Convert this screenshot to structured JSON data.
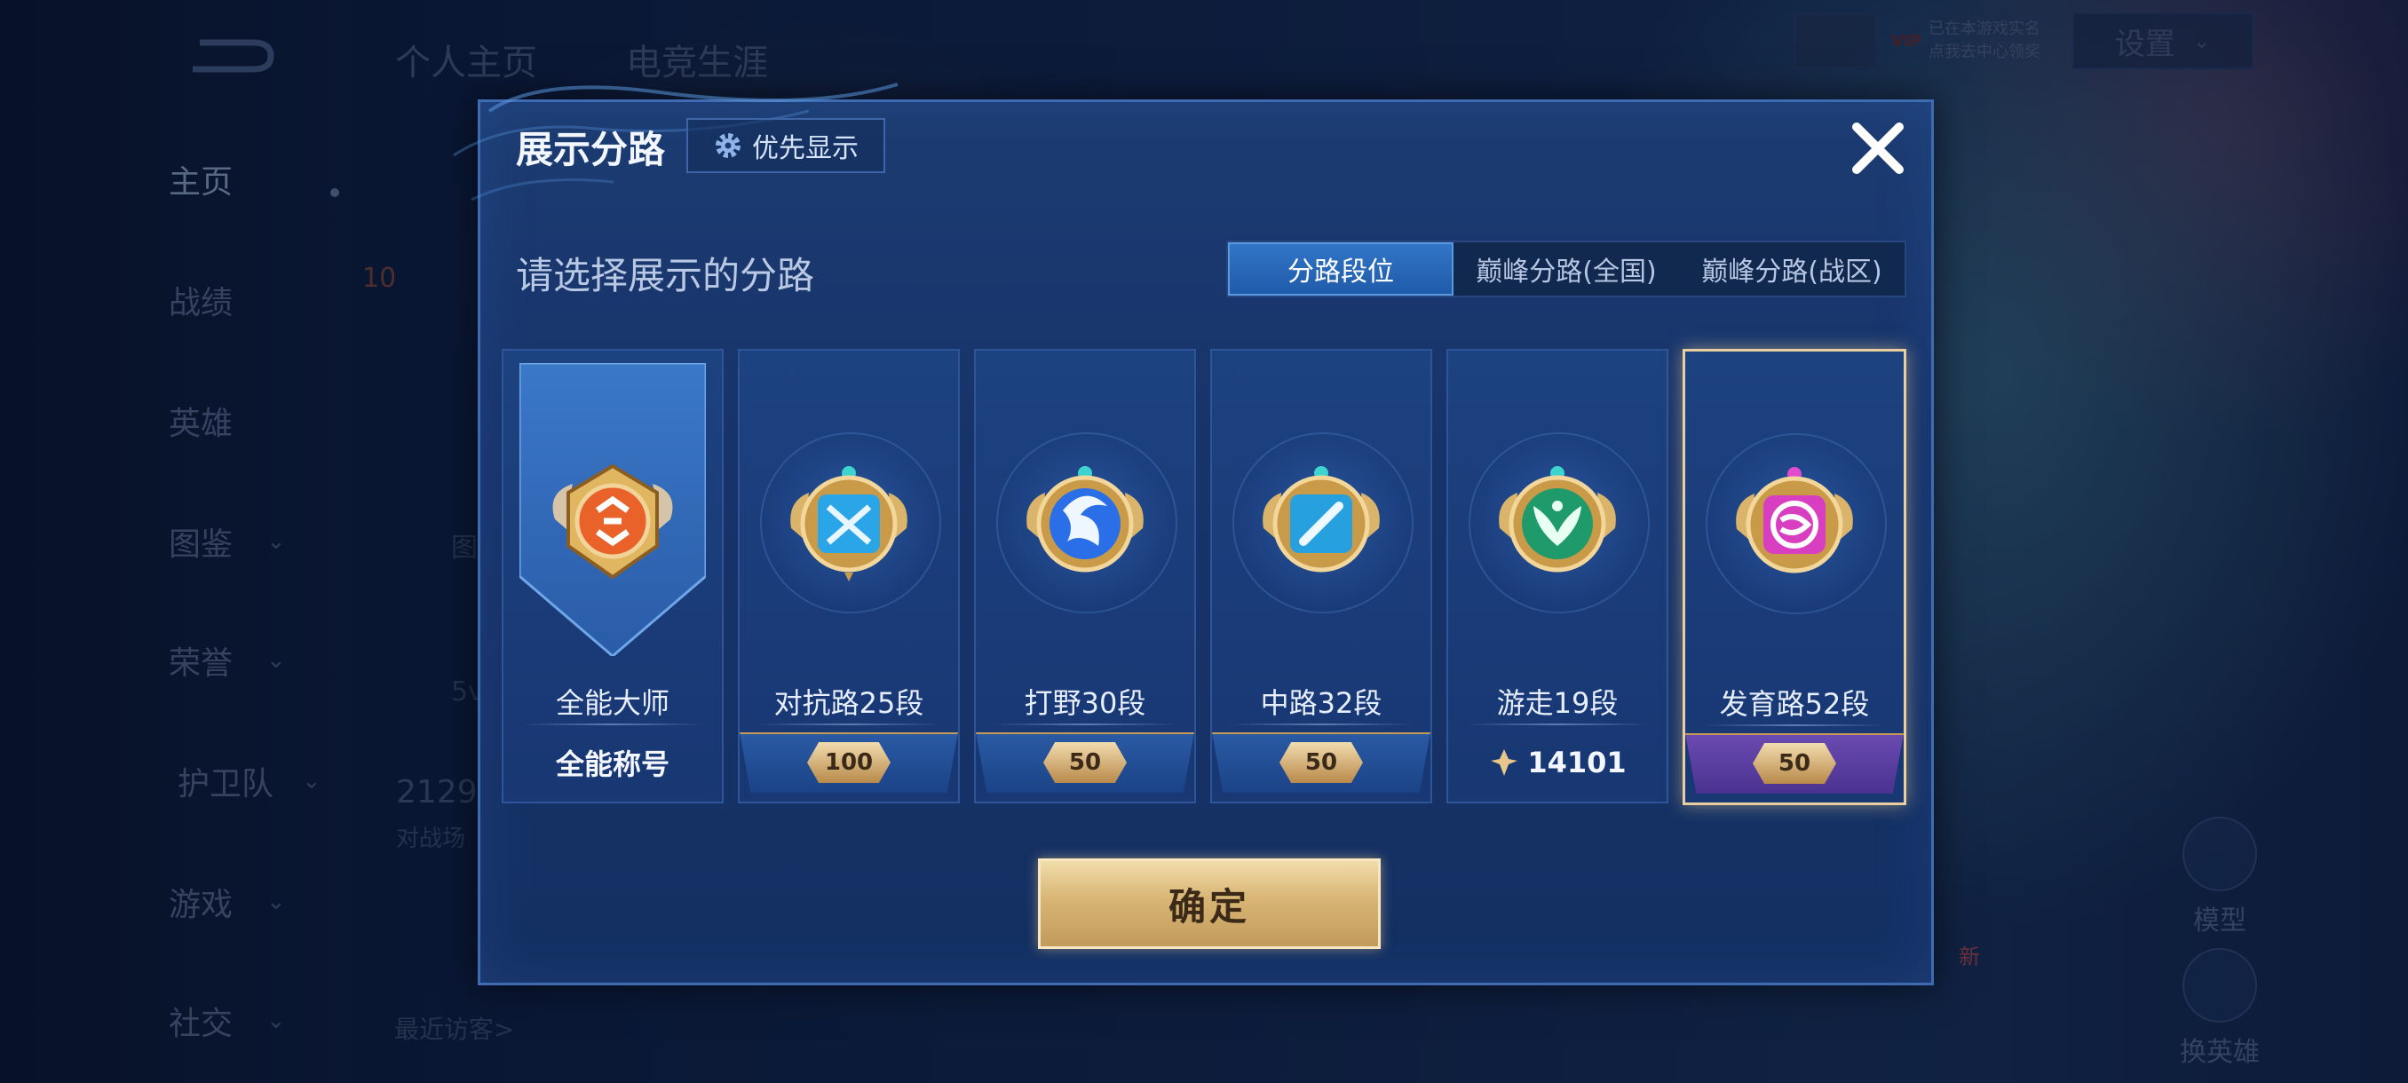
{
  "nav": {
    "items": [
      {
        "label": "主页",
        "has_chevron": false
      },
      {
        "label": "战绩",
        "has_chevron": false
      },
      {
        "label": "英雄",
        "has_chevron": false
      },
      {
        "label": "图鉴",
        "has_chevron": true
      },
      {
        "label": "荣誉",
        "has_chevron": true
      },
      {
        "label": "护卫队",
        "has_chevron": true
      },
      {
        "label": "游戏",
        "has_chevron": true
      },
      {
        "label": "社交",
        "has_chevron": true
      }
    ]
  },
  "header": {
    "tabs": [
      "个人主页",
      "电竞生涯"
    ],
    "vip_line1": "已在本游戏实名",
    "vip_line2": "点我去中心领奖",
    "vip_badge": "VIP",
    "settings_label": "设置"
  },
  "behind": {
    "level_badge": "10",
    "stat_number": "2129",
    "stat_caption": "对战场",
    "visitors_label": "最近访客>",
    "small_5": "5v",
    "tu_char": "图",
    "model_label": "模型",
    "change_hero_label": "换英雄",
    "new_badge": "新"
  },
  "modal": {
    "title": "展示分路",
    "priority_label": "优先显示",
    "prompt": "请选择展示的分路",
    "tabs": [
      "分路段位",
      "巅峰分路(全国)",
      "巅峰分路(战区)"
    ],
    "active_tab": 0,
    "cards": [
      {
        "label": "全能大师",
        "footer_text": "全能称号",
        "stars": null,
        "points": null,
        "badge_color": "#e8622a",
        "selected": false
      },
      {
        "label": "对抗路25段",
        "footer_text": null,
        "stars": "100",
        "points": null,
        "badge_color": "#2aa6e8",
        "selected": false
      },
      {
        "label": "打野30段",
        "footer_text": null,
        "stars": "50",
        "points": null,
        "badge_color": "#2a6ee8",
        "selected": false
      },
      {
        "label": "中路32段",
        "footer_text": null,
        "stars": "50",
        "points": null,
        "badge_color": "#27a0e0",
        "selected": false
      },
      {
        "label": "游走19段",
        "footer_text": null,
        "stars": null,
        "points": "14101",
        "badge_color": "#1f9a6a",
        "selected": false
      },
      {
        "label": "发育路52段",
        "footer_text": null,
        "stars": "50",
        "points": null,
        "badge_color": "#d83fc0",
        "selected": true
      }
    ],
    "confirm_label": "确定"
  },
  "colors": {
    "accent_gold": "#e9cfa0",
    "tab_active": "#2f6fc0",
    "modal_bg": "#17336a"
  }
}
